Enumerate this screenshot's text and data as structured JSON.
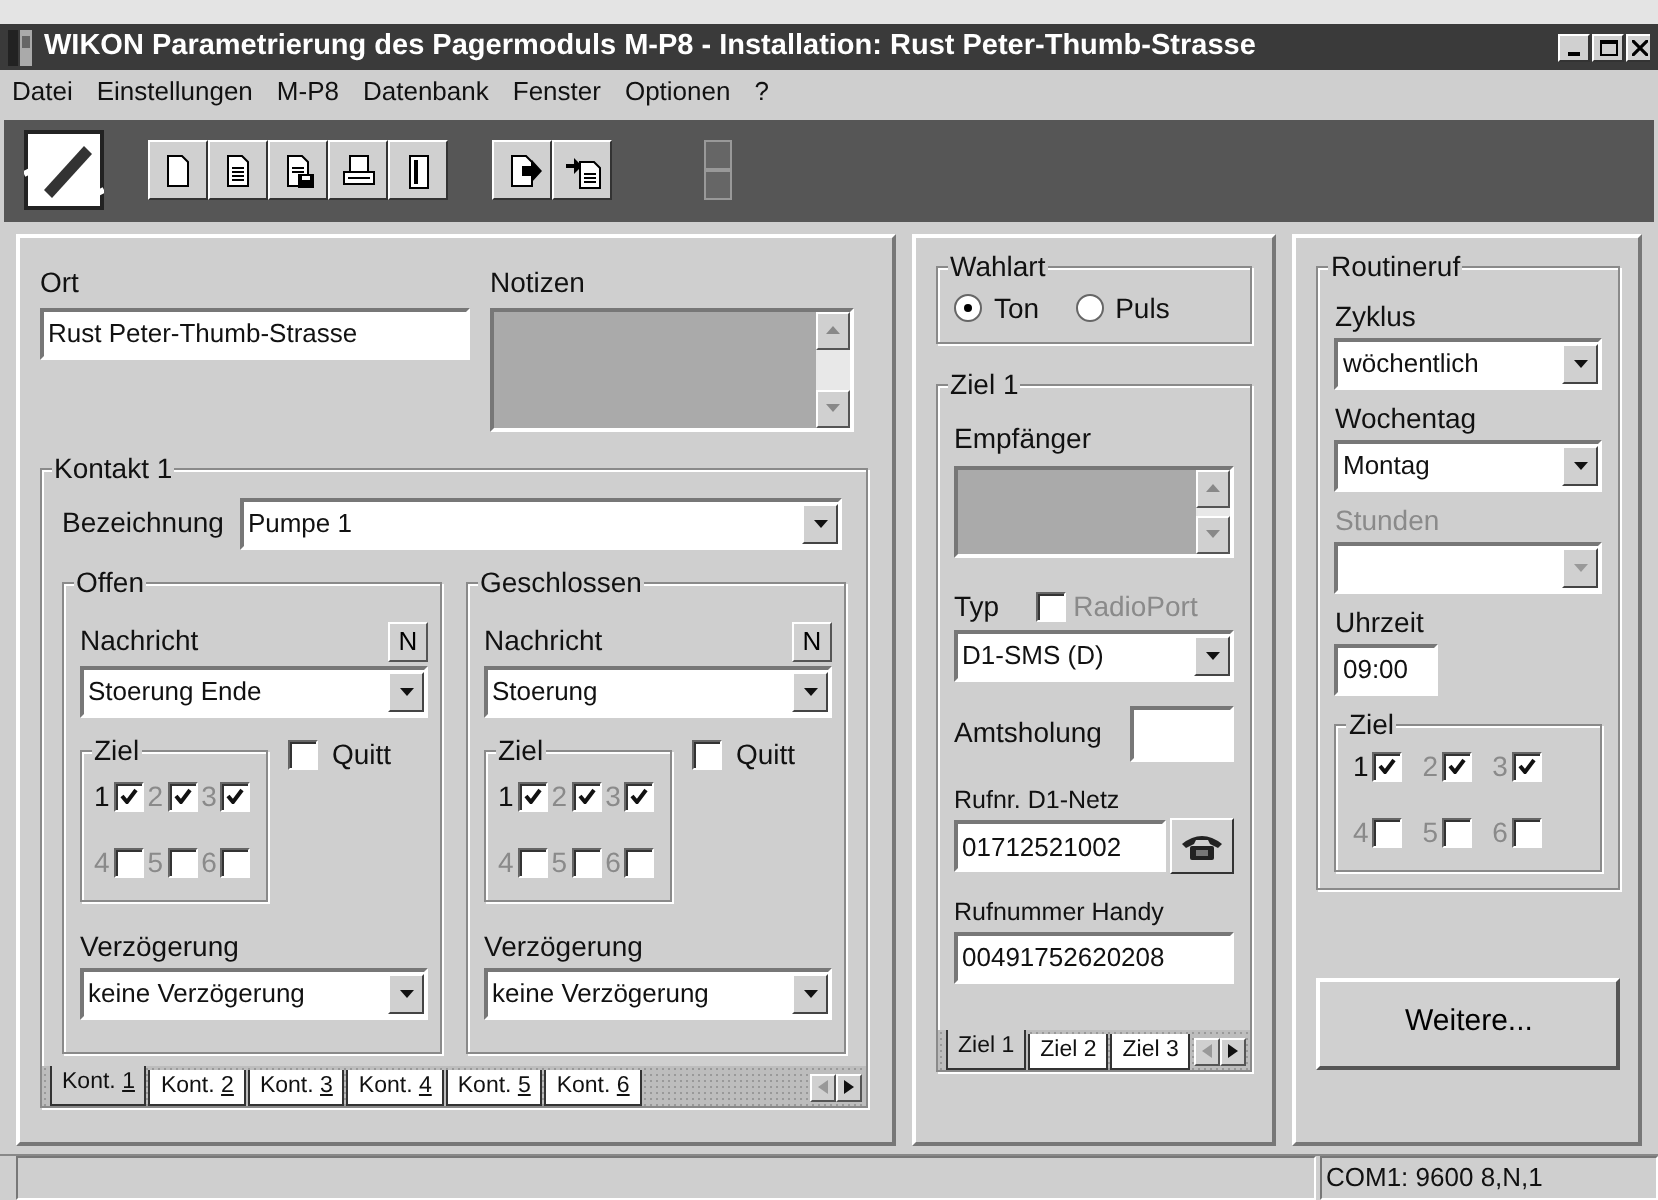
{
  "window": {
    "title": "WIKON Parametrierung des Pagermoduls M-P8 - Installation: Rust Peter-Thumb-Strasse"
  },
  "menu": [
    "Datei",
    "Einstellungen",
    "M-P8",
    "Datenbank",
    "Fenster",
    "Optionen",
    "?"
  ],
  "ort": {
    "label": "Ort",
    "value": "Rust Peter-Thumb-Strasse"
  },
  "notizen": {
    "label": "Notizen"
  },
  "kontakt": {
    "title": "Kontakt 1",
    "bezeichnung_label": "Bezeichnung",
    "bezeichnung": "Pumpe 1",
    "groups": [
      {
        "title": "Offen",
        "nachricht_label": "Nachricht",
        "n_button": "N",
        "nachricht": "Stoerung Ende",
        "ziel_title": "Ziel",
        "quitt": {
          "label": "Quitt",
          "checked": false
        },
        "verz_label": "Verzögerung",
        "verz": "keine Verzögerung",
        "ziel": [
          {
            "label": "1",
            "checked": true,
            "disabled": false
          },
          {
            "label": "2",
            "checked": true,
            "disabled": true
          },
          {
            "label": "3",
            "checked": true,
            "disabled": true
          },
          {
            "label": "4",
            "checked": false,
            "disabled": true
          },
          {
            "label": "5",
            "checked": false,
            "disabled": true
          },
          {
            "label": "6",
            "checked": false,
            "disabled": true
          }
        ]
      },
      {
        "title": "Geschlossen",
        "nachricht_label": "Nachricht",
        "n_button": "N",
        "nachricht": "Stoerung",
        "ziel_title": "Ziel",
        "quitt": {
          "label": "Quitt",
          "checked": false
        },
        "verz_label": "Verzögerung",
        "verz": "keine Verzögerung",
        "ziel": [
          {
            "label": "1",
            "checked": true,
            "disabled": false
          },
          {
            "label": "2",
            "checked": true,
            "disabled": true
          },
          {
            "label": "3",
            "checked": true,
            "disabled": true
          },
          {
            "label": "4",
            "checked": false,
            "disabled": true
          },
          {
            "label": "5",
            "checked": false,
            "disabled": true
          },
          {
            "label": "6",
            "checked": false,
            "disabled": true
          }
        ]
      }
    ]
  },
  "kontakt_tabs": [
    {
      "prefix": "Kont. ",
      "key": "1",
      "selected": true
    },
    {
      "prefix": "Kont. ",
      "key": "2",
      "selected": false
    },
    {
      "prefix": "Kont. ",
      "key": "3",
      "selected": false
    },
    {
      "prefix": "Kont. ",
      "key": "4",
      "selected": false
    },
    {
      "prefix": "Kont. ",
      "key": "5",
      "selected": false
    },
    {
      "prefix": "Kont. ",
      "key": "6",
      "selected": false
    }
  ],
  "wahlart": {
    "title": "Wahlart",
    "options": [
      {
        "label": "Ton",
        "selected": true
      },
      {
        "label": "Puls",
        "selected": false
      }
    ]
  },
  "ziel_panel": {
    "title": "Ziel 1",
    "empfaenger_label": "Empfänger",
    "typ_label": "Typ",
    "radioport": {
      "label": "RadioPort",
      "checked": false,
      "disabled": true
    },
    "typ": "D1-SMS (D)",
    "amts_label": "Amtsholung",
    "rufnr_label": "Rufnr. D1-Netz",
    "rufnr": "01712521002",
    "handy_label": "Rufnummer Handy",
    "handy": "00491752620208"
  },
  "ziel_tabs": [
    {
      "label": "Ziel 1",
      "selected": true
    },
    {
      "label": "Ziel 2",
      "selected": false
    },
    {
      "label": "Ziel 3",
      "selected": false
    }
  ],
  "routineruf": {
    "title": "Routineruf",
    "ziel_title": "Ziel",
    "fields": [
      {
        "kind": "select",
        "label": "Zyklus",
        "value": "wöchentlich",
        "disabled": false
      },
      {
        "kind": "select",
        "label": "Wochentag",
        "value": "Montag",
        "disabled": false
      },
      {
        "kind": "select",
        "label": "Stunden",
        "disabled": true
      },
      {
        "kind": "input",
        "label": "Uhrzeit",
        "value": "09:00",
        "disabled": false
      }
    ],
    "ziel": [
      {
        "label": "1",
        "checked": true,
        "disabled": false
      },
      {
        "label": "2",
        "checked": true,
        "disabled": true
      },
      {
        "label": "3",
        "checked": true,
        "disabled": true
      },
      {
        "label": "4",
        "checked": false,
        "disabled": true
      },
      {
        "label": "5",
        "checked": false,
        "disabled": true
      },
      {
        "label": "6",
        "checked": false,
        "disabled": true
      }
    ]
  },
  "weitere_button": "Weitere...",
  "status_bar": {
    "text": "COM1: 9600 8,N,1"
  }
}
